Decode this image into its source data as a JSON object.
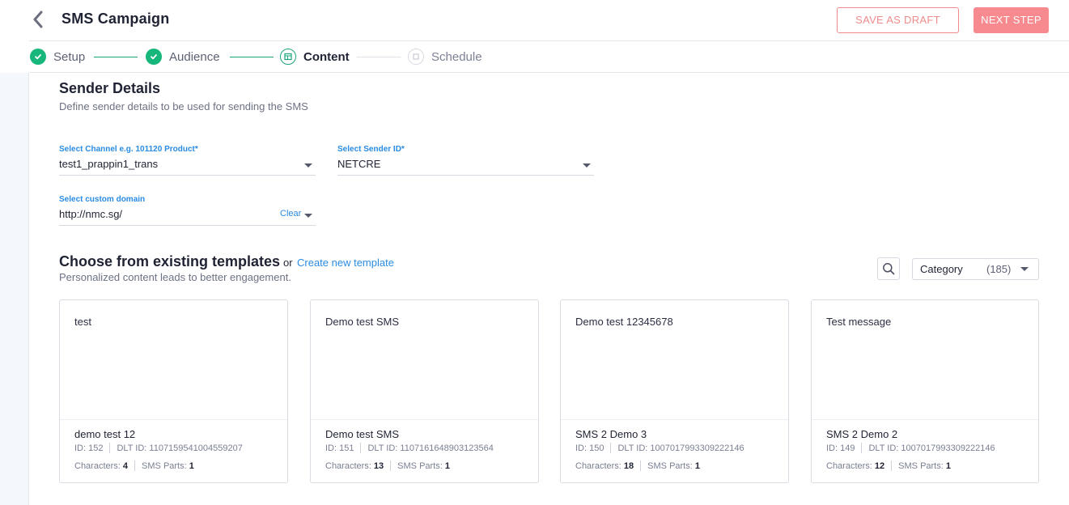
{
  "header": {
    "title": "SMS Campaign",
    "save_draft_label": "SAVE AS DRAFT",
    "next_step_label": "NEXT STEP"
  },
  "steps": [
    {
      "label": "Setup",
      "state": "done"
    },
    {
      "label": "Audience",
      "state": "done"
    },
    {
      "label": "Content",
      "state": "active"
    },
    {
      "label": "Schedule",
      "state": "todo"
    }
  ],
  "sender": {
    "title": "Sender Details",
    "subtitle": "Define sender details to be used for sending the SMS",
    "channel_label": "Select Channel e.g. 101120 Product*",
    "channel_value": "test1_prappin1_trans",
    "sender_id_label": "Select Sender ID*",
    "sender_id_value": "NETCRE",
    "domain_label": "Select custom domain",
    "domain_value": "http://nmc.sg/",
    "clear_label": "Clear"
  },
  "templates": {
    "title": "Choose from existing templates",
    "or_text": "or",
    "create_link": "Create new template",
    "subtitle": "Personalized content leads to better engagement.",
    "category_label": "Category",
    "category_count": "(185)",
    "cards": [
      {
        "message": "test",
        "name": "demo test 12",
        "id": "ID: 152",
        "dlt": "DLT ID: 1107159541004559207",
        "chars_label": "Characters:",
        "chars": "4",
        "parts_label": "SMS Parts:",
        "parts": "1"
      },
      {
        "message": "Demo test SMS",
        "name": "Demo test SMS",
        "id": "ID: 151",
        "dlt": "DLT ID: 1107161648903123564",
        "chars_label": "Characters:",
        "chars": "13",
        "parts_label": "SMS Parts:",
        "parts": "1"
      },
      {
        "message": "Demo test 12345678",
        "name": "SMS 2 Demo 3",
        "id": "ID: 150",
        "dlt": "DLT ID: 1007017993309222146",
        "chars_label": "Characters:",
        "chars": "18",
        "parts_label": "SMS Parts:",
        "parts": "1"
      },
      {
        "message": "Test message",
        "name": "SMS 2 Demo 2",
        "id": "ID: 149",
        "dlt": "DLT ID: 1007017993309222146",
        "chars_label": "Characters:",
        "chars": "12",
        "parts_label": "SMS Parts:",
        "parts": "1"
      }
    ]
  },
  "colors": {
    "accent_green": "#17b67a",
    "link_blue": "#2a8be2",
    "primary_button": "#f68a8f"
  },
  "icons": [
    "chevron-left-icon",
    "check-icon",
    "content-icon",
    "schedule-icon",
    "search-icon",
    "caret-down-icon"
  ]
}
